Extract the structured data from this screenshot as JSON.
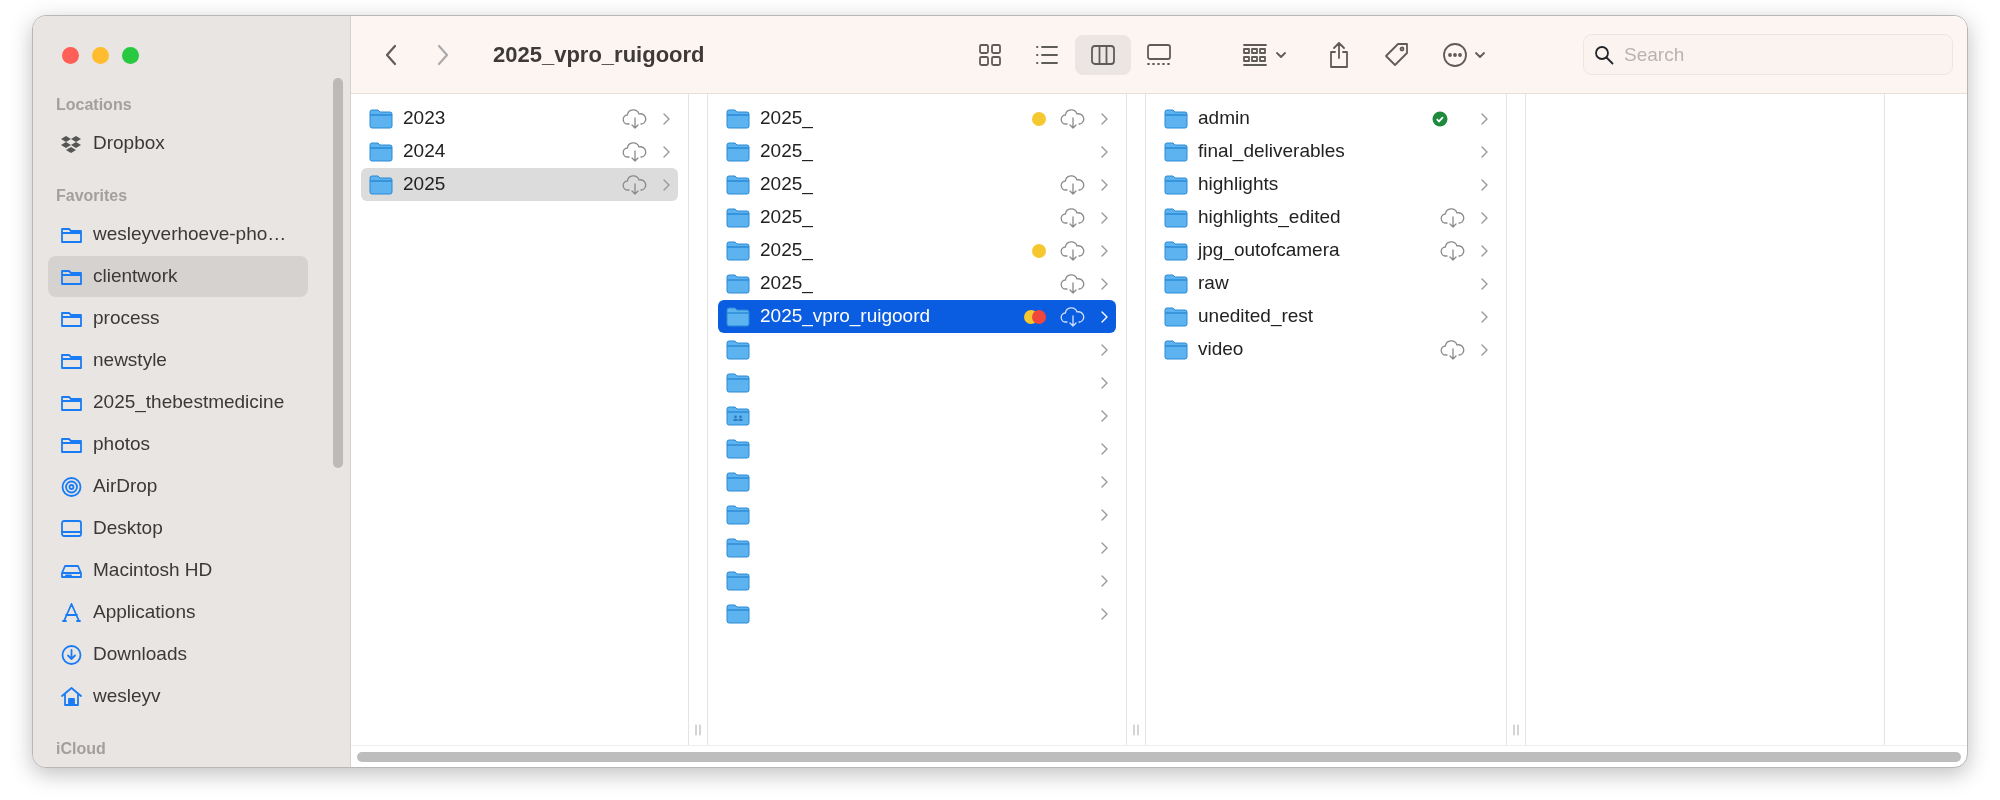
{
  "window": {
    "title": "2025_vpro_ruigoord"
  },
  "sidebar": {
    "sections": [
      {
        "title": "Locations",
        "items": [
          {
            "label": "Dropbox",
            "kind": "dropbox",
            "selected": false
          }
        ]
      },
      {
        "title": "Favorites",
        "items": [
          {
            "label": "wesleyverhoeve-pho…",
            "kind": "folder",
            "selected": false
          },
          {
            "label": "clientwork",
            "kind": "folder",
            "selected": true
          },
          {
            "label": "process",
            "kind": "folder",
            "selected": false
          },
          {
            "label": "newstyle",
            "kind": "folder",
            "selected": false
          },
          {
            "label": "2025_thebestmedicine",
            "kind": "folder",
            "selected": false
          },
          {
            "label": "photos",
            "kind": "folder",
            "selected": false
          },
          {
            "label": "AirDrop",
            "kind": "airdrop",
            "selected": false
          },
          {
            "label": "Desktop",
            "kind": "desktop",
            "selected": false
          },
          {
            "label": "Macintosh HD",
            "kind": "drive",
            "selected": false
          },
          {
            "label": "Applications",
            "kind": "applications",
            "selected": false
          },
          {
            "label": "Downloads",
            "kind": "downloads",
            "selected": false
          },
          {
            "label": "wesleyv",
            "kind": "home",
            "selected": false
          }
        ]
      },
      {
        "title": "iCloud"
      }
    ]
  },
  "toolbar": {
    "view_modes": [
      {
        "kind": "icons",
        "selected": false
      },
      {
        "kind": "list",
        "selected": false
      },
      {
        "kind": "columns",
        "selected": true
      },
      {
        "kind": "gallery",
        "selected": false
      }
    ],
    "search": {
      "placeholder": "Search"
    }
  },
  "columns": [
    {
      "focused": false,
      "items": [
        {
          "name": "2023",
          "kind": "folder",
          "cloud": true,
          "selected": false
        },
        {
          "name": "2024",
          "kind": "folder",
          "cloud": true,
          "selected": false
        },
        {
          "name": "2025",
          "kind": "folder",
          "cloud": true,
          "selected": true
        }
      ]
    },
    {
      "focused": true,
      "items": [
        {
          "name": "2025_",
          "kind": "folder",
          "cloud": true,
          "selected": false,
          "tags": [
            {
              "color": "#f5c830"
            }
          ]
        },
        {
          "name": "2025_",
          "kind": "folder",
          "cloud": false,
          "selected": false
        },
        {
          "name": "2025_",
          "kind": "folder",
          "cloud": true,
          "selected": false
        },
        {
          "name": "2025_",
          "kind": "folder",
          "cloud": true,
          "selected": false
        },
        {
          "name": "2025_",
          "kind": "folder",
          "cloud": true,
          "selected": false,
          "tags": [
            {
              "color": "#f5c830"
            }
          ]
        },
        {
          "name": "2025_",
          "kind": "folder",
          "cloud": true,
          "selected": false
        },
        {
          "name": "2025_vpro_ruigoord",
          "kind": "folder",
          "cloud": true,
          "selected": true,
          "tags": [
            {
              "color": "#f5c830"
            },
            {
              "color": "#f0463c"
            }
          ]
        },
        {
          "kind": "folder",
          "cloud": false,
          "selected": false
        },
        {
          "kind": "folder",
          "cloud": false,
          "selected": false
        },
        {
          "kind": "shared",
          "cloud": false,
          "selected": false
        },
        {
          "kind": "folder",
          "cloud": false,
          "selected": false
        },
        {
          "kind": "folder",
          "cloud": false,
          "selected": false
        },
        {
          "kind": "folder",
          "cloud": false,
          "selected": false
        },
        {
          "kind": "folder",
          "cloud": false,
          "selected": false
        },
        {
          "kind": "folder",
          "cloud": false,
          "selected": false
        },
        {
          "kind": "folder",
          "cloud": false,
          "selected": false
        }
      ]
    },
    {
      "items": [
        {
          "name": "admin",
          "kind": "folder",
          "cloud": false,
          "synced": true,
          "selected": false
        },
        {
          "name": "final_deliverables",
          "kind": "folder",
          "cloud": false,
          "synced": false,
          "selected": false
        },
        {
          "name": "highlights",
          "kind": "folder",
          "cloud": false,
          "synced": false,
          "selected": false
        },
        {
          "name": "highlights_edited",
          "kind": "folder",
          "cloud": true,
          "synced": false,
          "selected": false
        },
        {
          "name": "jpg_outofcamera",
          "kind": "folder",
          "cloud": true,
          "synced": false,
          "selected": false
        },
        {
          "name": "raw",
          "kind": "folder",
          "cloud": false,
          "synced": false,
          "selected": false
        },
        {
          "name": "unedited_rest",
          "kind": "folder",
          "cloud": false,
          "synced": false,
          "selected": false
        },
        {
          "name": "video",
          "kind": "folder",
          "cloud": true,
          "synced": false,
          "selected": false
        }
      ]
    }
  ]
}
